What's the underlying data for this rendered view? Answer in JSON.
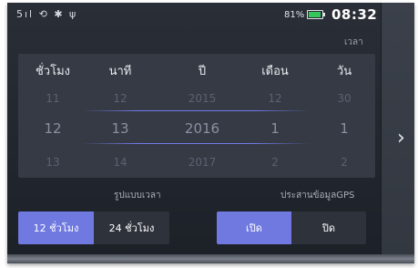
{
  "status_bar": {
    "signal_icons": "5ıl ⟲ ✱ ψ",
    "battery_percent": "81%",
    "battery_level": 0.81,
    "time": "08:32"
  },
  "page_title": "เวลา",
  "picker": {
    "columns": [
      {
        "header": "ชั่วโมง",
        "prev": "11",
        "current": "12",
        "next": "13"
      },
      {
        "header": "นาที",
        "prev": "12",
        "current": "13",
        "next": "14"
      },
      {
        "header": "ปี",
        "prev": "2015",
        "current": "2016",
        "next": "2017"
      },
      {
        "header": "เดือน",
        "prev": "12",
        "current": "1",
        "next": "2"
      },
      {
        "header": "วัน",
        "prev": "30",
        "current": "1",
        "next": "2"
      }
    ]
  },
  "time_format": {
    "label": "รูปแบบเวลา",
    "option_12h": "12 ชั่วโมง",
    "option_24h": "24 ชั่วโมง",
    "selected": "12h"
  },
  "gps_sync": {
    "label": "ประสานข้อมูลGPS",
    "on_label": "เปิด",
    "off_label": "ปิด",
    "selected": "on"
  },
  "colors": {
    "accent": "#6f79e0",
    "panel": "#353a45",
    "background": "#262a31"
  },
  "icons": {
    "next": "chevron-right-icon"
  }
}
